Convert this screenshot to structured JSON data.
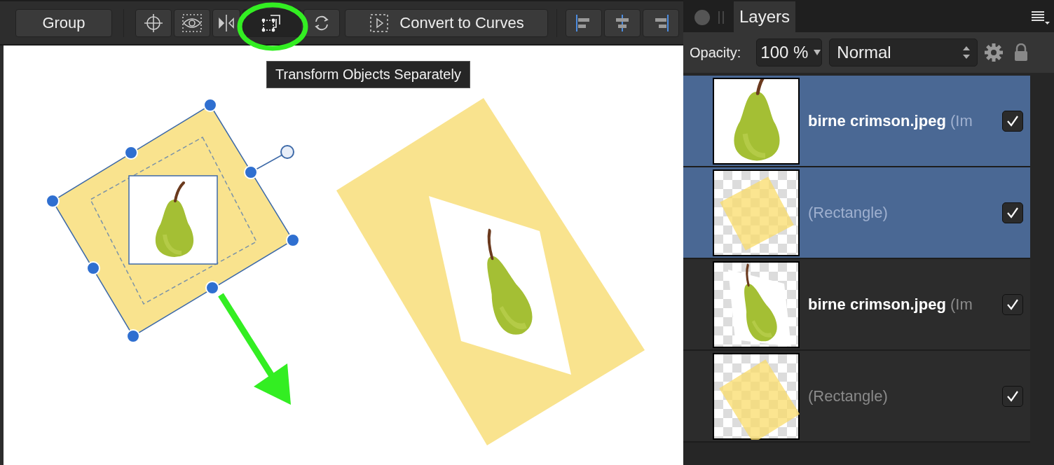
{
  "toolbar": {
    "group_label": "Group",
    "transform_separately_pressed": true,
    "convert_label": "Convert to Curves"
  },
  "tooltip": "Transform Objects Separately",
  "panel": {
    "tabs": [
      {
        "label": "Layers",
        "selected": true
      }
    ],
    "opacity_label": "Opacity:",
    "opacity": "100 %",
    "blend_mode": "Normal",
    "layers": [
      {
        "kind": "image",
        "name": "birne crimson.jpeg",
        "type": "(Im",
        "selected": true,
        "visible": true
      },
      {
        "kind": "shape",
        "type": "(Rectangle)",
        "selected": true,
        "visible": true
      },
      {
        "kind": "image",
        "name": "birne crimson.jpeg",
        "type": "(Im",
        "selected": false,
        "visible": true
      },
      {
        "kind": "shape",
        "type": "(Rectangle)",
        "selected": false,
        "visible": true
      }
    ]
  }
}
